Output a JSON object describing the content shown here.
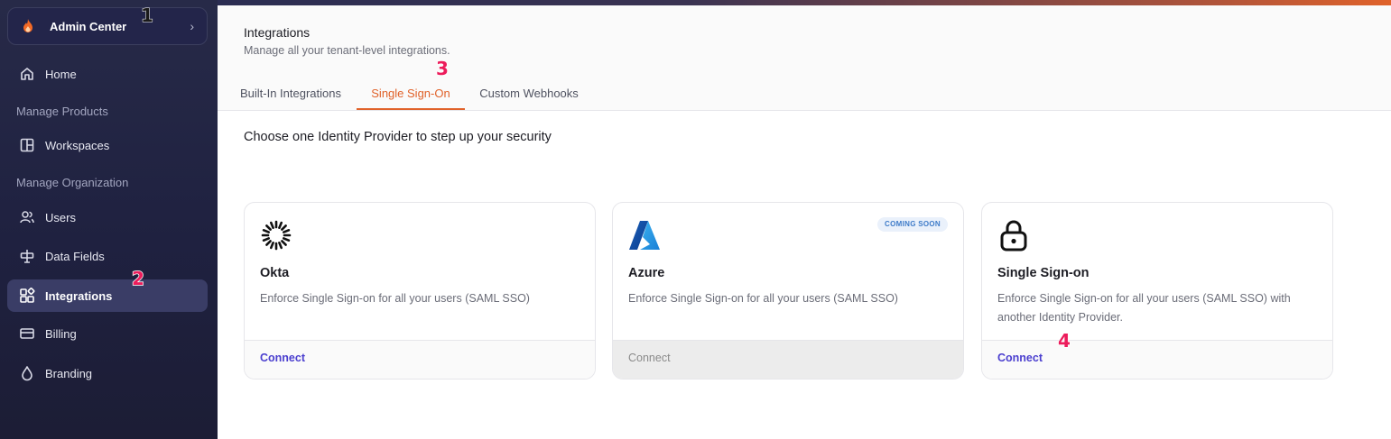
{
  "sidebar": {
    "org": {
      "title": "Admin Center",
      "chevron": "›"
    },
    "items": [
      {
        "label": "Home",
        "icon": "home-icon"
      },
      {
        "label": "Workspaces",
        "icon": "workspaces-icon"
      },
      {
        "label": "Users",
        "icon": "users-icon"
      },
      {
        "label": "Data Fields",
        "icon": "data-fields-icon"
      },
      {
        "label": "Integrations",
        "icon": "integrations-icon",
        "active": true
      },
      {
        "label": "Billing",
        "icon": "billing-icon"
      },
      {
        "label": "Branding",
        "icon": "branding-icon"
      }
    ],
    "sections": [
      "Manage Products",
      "Manage Organization"
    ]
  },
  "header": {
    "title": "Integrations",
    "subtitle": "Manage all your tenant-level integrations."
  },
  "tabs": [
    {
      "label": "Built-In Integrations"
    },
    {
      "label": "Single Sign-On",
      "active": true
    },
    {
      "label": "Custom Webhooks"
    }
  ],
  "main": {
    "heading": "Choose one Identity Provider to step up your security",
    "cards": [
      {
        "name": "Okta",
        "description": "Enforce Single Sign-on for all your users (SAML SSO)",
        "action": "Connect",
        "icon": "okta-logo-icon"
      },
      {
        "name": "Azure",
        "description": "Enforce Single Sign-on for all your users (SAML SSO)",
        "action": "Connect",
        "badge": "COMING SOON",
        "disabled": true,
        "icon": "azure-logo-icon"
      },
      {
        "name": "Single Sign-on",
        "description": "Enforce Single Sign-on for all your users (SAML SSO) with another Identity Provider.",
        "action": "Connect",
        "icon": "lock-icon"
      }
    ]
  },
  "markers": [
    "1",
    "2",
    "3",
    "4"
  ],
  "colors": {
    "accent": "#e0622a",
    "link": "#4b3fcf",
    "sidebar_bg": "#1f2140",
    "marker": "#ec1c5b"
  }
}
